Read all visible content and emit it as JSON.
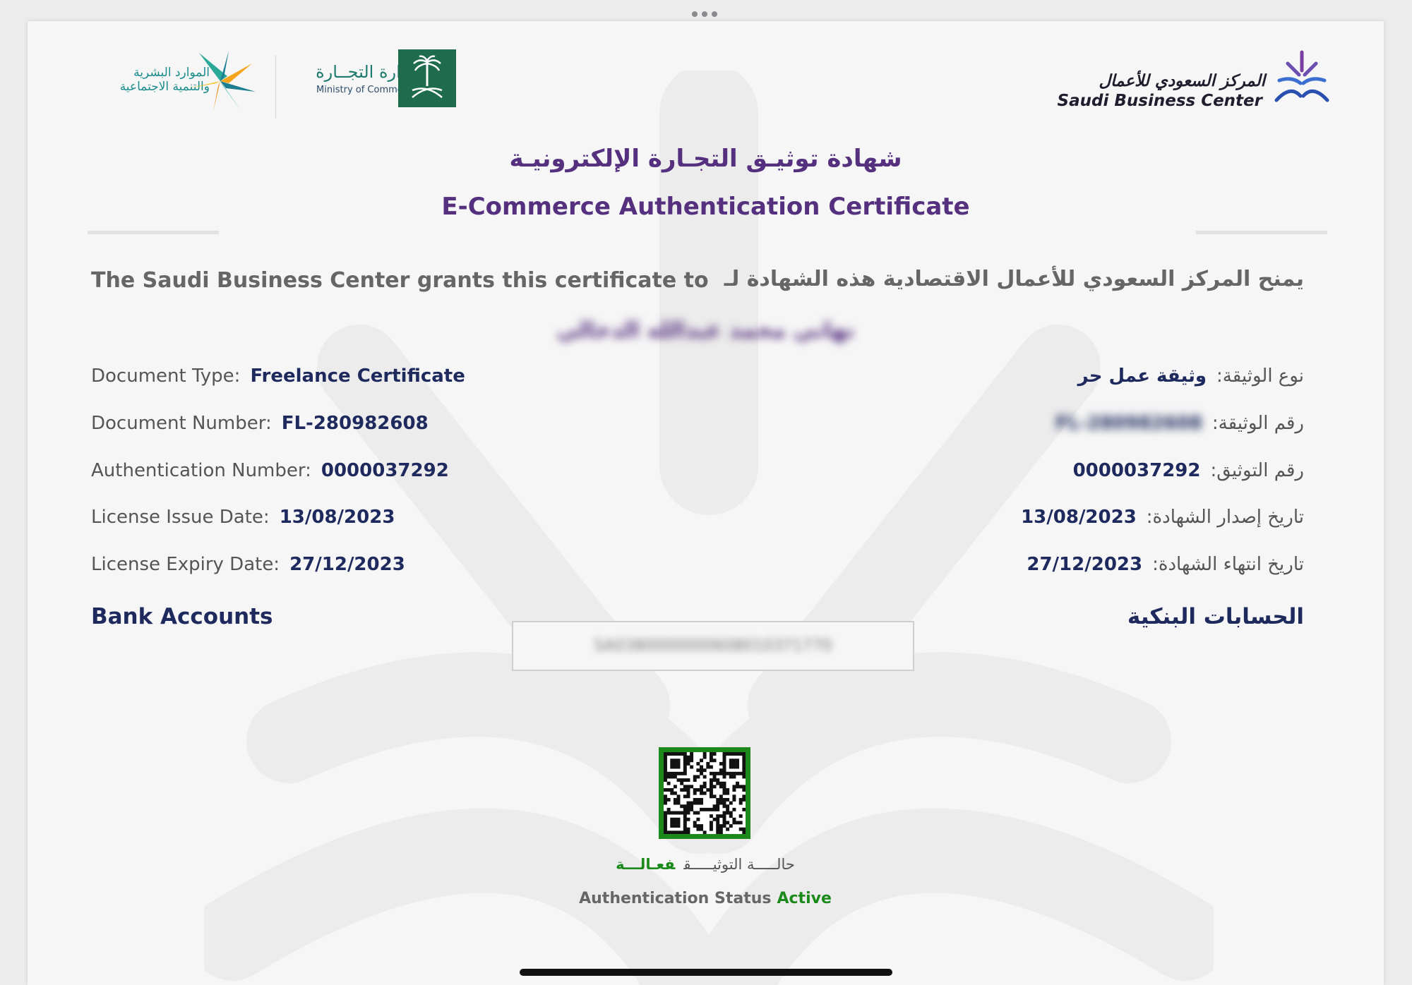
{
  "header": {
    "sbc_name_ar": "المركز السعودي للأعمال",
    "sbc_name_en": "Saudi Business Center",
    "moc_name_ar": "وزارة التجــارة",
    "moc_name_en": "Ministry of Commerce",
    "hr_name_ar_line1": "الموارد البشرية",
    "hr_name_ar_line2": "والتنمية الاجتماعية"
  },
  "certificate": {
    "title_ar": "شهادة توثيـق التجـارة الإلكترونيـة",
    "title_en": "E-Commerce Authentication Certificate",
    "grant_en": "The Saudi Business Center grants this certificate to",
    "grant_ar": "يمنح المركز السعودي للأعمال الاقتصادية هذه الشهادة لـ",
    "holder_name": "نهاني محمد عبدالله الدخالي"
  },
  "fields_en": [
    {
      "label": "Document Type:",
      "value": "Freelance Certificate"
    },
    {
      "label": "Document Number:",
      "value": "FL-280982608"
    },
    {
      "label": "Authentication Number:",
      "value": "0000037292"
    },
    {
      "label": "License Issue Date:",
      "value": "13/08/2023"
    },
    {
      "label": "License Expiry Date:",
      "value": "27/12/2023"
    }
  ],
  "fields_ar": [
    {
      "label": "نوع الوثيقة:",
      "value": "وثيقة عمل حر"
    },
    {
      "label": "رقم الوثيقة:",
      "value": "FL-280982608"
    },
    {
      "label": "رقم التوثيق:",
      "value": "0000037292"
    },
    {
      "label": "تاريخ إصدار الشهادة:",
      "value": "13/08/2023"
    },
    {
      "label": "تاريخ انتهاء الشهادة:",
      "value": "27/12/2023"
    }
  ],
  "bank": {
    "heading_en": "Bank Accounts",
    "heading_ar": "الحسابات البنكية",
    "iban": "SA0380000000608010371770"
  },
  "status": {
    "label_ar": "حالـــــة التوثيـــــق",
    "value_ar": "فعـالـــة",
    "label_en": "Authentication Status",
    "value_en": "Active"
  },
  "colors": {
    "title_purple": "#55307f",
    "value_navy": "#1e2a5e",
    "active_green": "#1b8a1b",
    "moc_green": "#1e6b4e"
  }
}
